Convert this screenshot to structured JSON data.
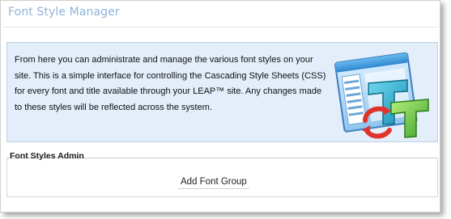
{
  "page": {
    "title": "Font Style Manager"
  },
  "info": {
    "line1": "From here you can administrate and manage the various font styles on your",
    "line2": "site. This is a simple interface for controlling the Cascading Style Sheets (CSS)",
    "line3": "for every font and title available through your LEAP™ site. Any changes made",
    "line4": "to these styles will be reflected across the system.",
    "graphic_icon": "css-font-style-editor-icon"
  },
  "admin": {
    "legend": "Font Styles Admin",
    "add_button_label": "Add Font Group"
  },
  "colors": {
    "title": "#8fb3d9",
    "panel_bg": "#e3eefa",
    "panel_border": "#bcd1e6",
    "accent_green": "#57c038",
    "accent_cyan": "#27a8c9",
    "accent_red": "#e0332b"
  }
}
